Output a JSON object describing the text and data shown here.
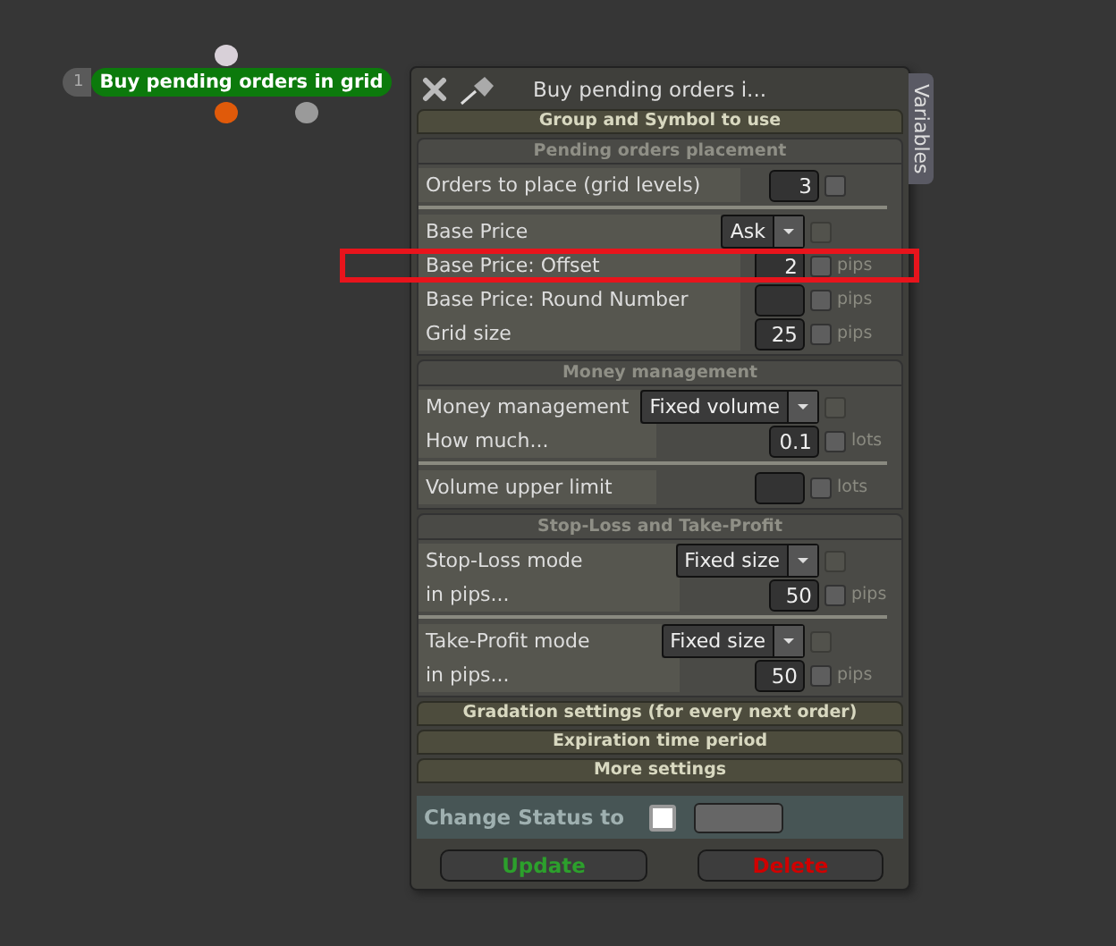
{
  "node": {
    "number": "1",
    "title": "Buy pending orders in grid"
  },
  "panel": {
    "title": "Buy pending orders i...",
    "side_tab": "Variables",
    "sections": [
      {
        "kind": "bar",
        "title": "Group and Symbol to use"
      },
      {
        "kind": "group",
        "title": "Pending orders placement",
        "blocks": [
          [
            {
              "label": "Orders to place (grid levels)",
              "kind": "number",
              "value": "3",
              "checked": false,
              "highlighted": false
            }
          ],
          [
            {
              "label": "Base Price",
              "kind": "select",
              "value": "Ask",
              "checked": false,
              "highlighted": false
            },
            {
              "label": "Base Price: Offset",
              "kind": "number",
              "value": "2",
              "unit": "pips",
              "checked": false,
              "highlighted": true
            },
            {
              "label": "Base Price: Round Number",
              "kind": "number",
              "unit": "pips",
              "checked": false,
              "highlighted": false
            },
            {
              "label": "Grid size",
              "kind": "number",
              "value": "25",
              "unit": "pips",
              "checked": false,
              "highlighted": false
            }
          ]
        ]
      },
      {
        "kind": "group",
        "title": "Money management",
        "blocks": [
          [
            {
              "label": "Money management",
              "kind": "select",
              "value": "Fixed volume",
              "checked": false,
              "highlighted": false
            },
            {
              "label": "How much...",
              "kind": "number",
              "value": "0.1",
              "unit": "lots",
              "checked": false,
              "highlighted": false
            }
          ],
          [
            {
              "label": "Volume upper limit",
              "kind": "number",
              "unit": "lots",
              "checked": false,
              "highlighted": false
            }
          ]
        ]
      },
      {
        "kind": "group",
        "title": "Stop-Loss and Take-Profit",
        "blocks": [
          [
            {
              "label": "Stop-Loss mode",
              "kind": "select",
              "value": "Fixed size",
              "checked": false,
              "highlighted": false
            },
            {
              "label": "in pips...",
              "kind": "number",
              "value": "50",
              "unit": "pips",
              "checked": false,
              "highlighted": false
            }
          ],
          [
            {
              "label": "Take-Profit mode",
              "kind": "select",
              "value": "Fixed size",
              "checked": false,
              "highlighted": false
            },
            {
              "label": "in pips...",
              "kind": "number",
              "value": "50",
              "unit": "pips",
              "checked": false,
              "highlighted": false
            }
          ]
        ]
      },
      {
        "kind": "bar",
        "title": "Gradation settings (for every next order)"
      },
      {
        "kind": "bar",
        "title": "Expiration time period"
      },
      {
        "kind": "bar",
        "title": "More settings"
      }
    ],
    "status": {
      "label": "Change Status to",
      "checked": false
    },
    "buttons": [
      {
        "label": "Update",
        "kind": "update"
      },
      {
        "label": "Delete",
        "kind": "delete"
      }
    ]
  }
}
